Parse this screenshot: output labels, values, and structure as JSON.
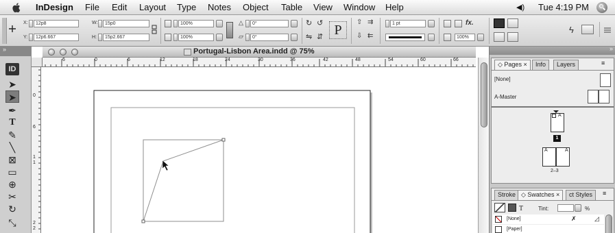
{
  "menubar": {
    "app_name": "InDesign",
    "items": [
      "File",
      "Edit",
      "Layout",
      "Type",
      "Notes",
      "Object",
      "Table",
      "View",
      "Window",
      "Help"
    ],
    "volume_glyph": "◀)",
    "clock": "Tue 4:19 PM"
  },
  "control_panel": {
    "x_label": "X:",
    "x_value": "12p8",
    "y_label": "Y:",
    "y_value": "12p6.667",
    "w_label": "W:",
    "w_value": "15p0",
    "h_label": "H:",
    "h_value": "15p2.667",
    "scale_x_value": "100%",
    "scale_y_value": "100%",
    "rotate_value": "0°",
    "shear_value": "0°",
    "stroke_weight_value": "1 pt",
    "opacity_value": "100%",
    "fx_label": "fx."
  },
  "document": {
    "title": "Portugal-Lisbon Area.indd @ 75%",
    "hruler_ticks": [
      "6",
      "0",
      "6",
      "12",
      "18",
      "24",
      "30",
      "36",
      "42",
      "48",
      "54",
      "60",
      "66"
    ],
    "vruler_ticks": [
      "0",
      "6",
      "1",
      "1",
      "2",
      "2"
    ]
  },
  "tools": {
    "logo": "ID",
    "items": [
      "selection-tool",
      "direct-selection-tool",
      "pen-tool",
      "type-tool",
      "pencil-tool",
      "line-tool",
      "rectangle-frame-tool",
      "rectangle-tool",
      "button-tool",
      "scissors-tool",
      "rotate-tool",
      "free-transform-tool"
    ]
  },
  "pages_panel": {
    "tabs": [
      "Pages",
      "Info",
      "Layers"
    ],
    "none_label": "[None]",
    "master_label": "A-Master",
    "page_number": "1",
    "spread_label": "2–3",
    "master_letter": "A"
  },
  "swatches_panel": {
    "tabs": [
      "Stroke",
      "Swatches",
      "ct Styles"
    ],
    "tint_label": "Tint:",
    "tint_unit": "%",
    "swatches": [
      "[None]",
      "[Paper]"
    ]
  },
  "colors": {
    "menubar_bg": "#e8e8e8",
    "dock_bg": "#c8c8c8",
    "panel_bg": "#ededed",
    "selection_line": "#8e8e8e"
  }
}
